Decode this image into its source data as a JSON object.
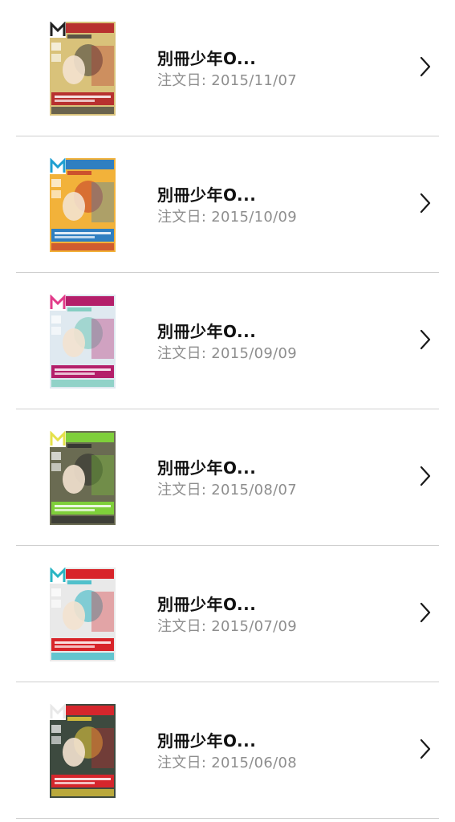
{
  "orders": [
    {
      "title": "別冊少年O...",
      "date_label": "注文日: 2015/11/07",
      "cover": {
        "bg": "#d9c27a",
        "band": "#b8312f",
        "accent": "#3a3a3a",
        "logo": "#222222"
      }
    },
    {
      "title": "別冊少年O...",
      "date_label": "注文日: 2015/10/09",
      "cover": {
        "bg": "#f2b23a",
        "band": "#2f7fc1",
        "accent": "#c2382b",
        "logo": "#1f9fd1"
      }
    },
    {
      "title": "別冊少年O...",
      "date_label": "注文日: 2015/09/09",
      "cover": {
        "bg": "#dfe9f0",
        "band": "#b41f6a",
        "accent": "#6fc7b6",
        "logo": "#e23c8a"
      }
    },
    {
      "title": "別冊少年O...",
      "date_label": "注文日: 2015/08/07",
      "cover": {
        "bg": "#6a6b52",
        "band": "#7fcf3a",
        "accent": "#2c2c2c",
        "logo": "#e5e14a"
      }
    },
    {
      "title": "別冊少年O...",
      "date_label": "注文日: 2015/07/09",
      "cover": {
        "bg": "#e9e9e9",
        "band": "#d8242a",
        "accent": "#2ab5c3",
        "logo": "#2ab5c3"
      }
    },
    {
      "title": "別冊少年O...",
      "date_label": "注文日: 2015/06/08",
      "cover": {
        "bg": "#3d4a3f",
        "band": "#d5262c",
        "accent": "#f0d23c",
        "logo": "#e8e8e8"
      }
    }
  ],
  "icons": {
    "cover": "magazine-cover-icon",
    "chevron": "chevron-right-icon"
  }
}
